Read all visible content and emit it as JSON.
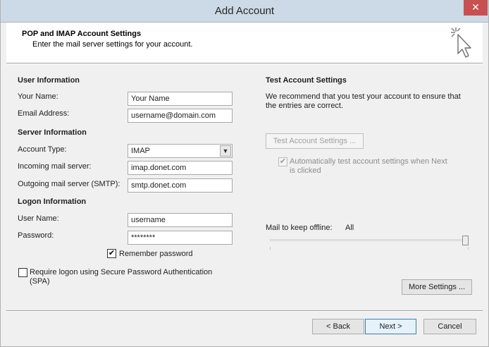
{
  "window": {
    "title": "Add Account",
    "close_glyph": "✕"
  },
  "header": {
    "title": "POP and IMAP Account Settings",
    "subtitle": "Enter the mail server settings for your account.",
    "icon": "pointer-click-icon"
  },
  "user_info": {
    "heading": "User Information",
    "name_label": "Your Name:",
    "name_value": "Your Name",
    "email_label": "Email Address:",
    "email_value": "username@domain.com"
  },
  "server_info": {
    "heading": "Server Information",
    "account_type_label": "Account Type:",
    "account_type_value": "IMAP",
    "incoming_label": "Incoming mail server:",
    "incoming_value": "imap.donet.com",
    "outgoing_label": "Outgoing mail server (SMTP):",
    "outgoing_value": "smtp.donet.com"
  },
  "logon_info": {
    "heading": "Logon Information",
    "username_label": "User Name:",
    "username_value": "username",
    "password_label": "Password:",
    "password_value": "********",
    "remember_label": "Remember password",
    "remember_checked": true,
    "spa_label_line1": "Require logon using Secure Password Authentication",
    "spa_label_line2": "(SPA)",
    "spa_checked": false
  },
  "test_settings": {
    "heading": "Test Account Settings",
    "desc_line1": "We recommend that you test your account to ensure that",
    "desc_line2": "the entries are correct.",
    "button_label": "Test Account Settings ...",
    "auto_label_line1": "Automatically test account settings when Next",
    "auto_label_line2": "is clicked",
    "auto_checked": true
  },
  "offline": {
    "label": "Mail to keep offline:",
    "value": "All",
    "level_fraction": 1.0
  },
  "buttons": {
    "more_settings": "More Settings ...",
    "back": "< Back",
    "next": "Next >",
    "cancel": "Cancel"
  },
  "check_glyph": "✔"
}
